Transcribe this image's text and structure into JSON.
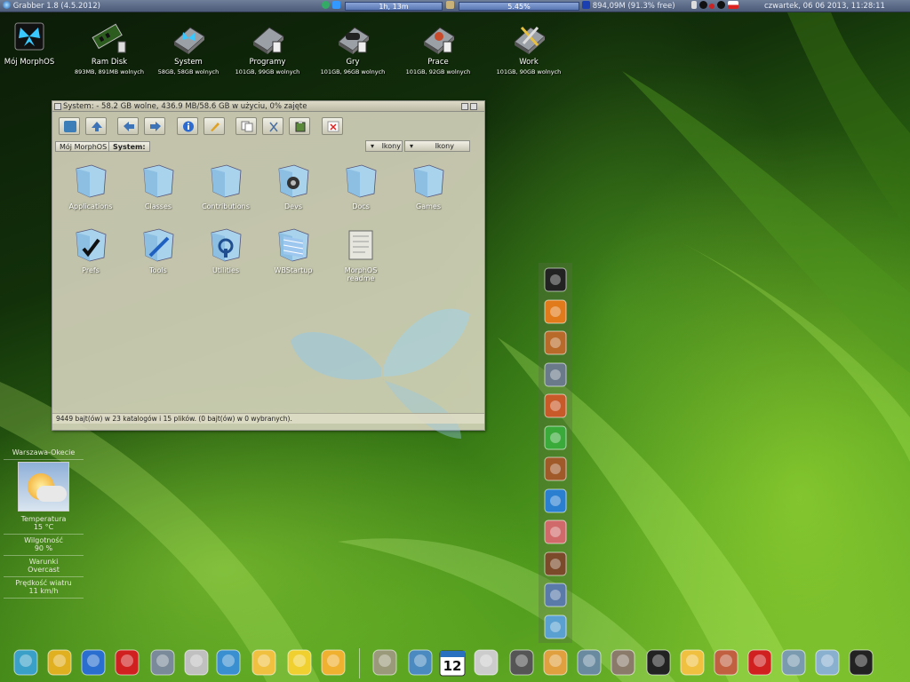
{
  "menubar": {
    "app_title": "Grabber 1.8 (4.5.2012)",
    "uptime": "1h, 13m",
    "cpu": "5.45%",
    "memory": "894,09M (91.3% free)",
    "datetime": "czwartek, 06 06 2013, 11:28:11"
  },
  "desktop_icons": [
    {
      "label": "Mój MorphOS",
      "sub": "",
      "icon": "butterfly-icon"
    },
    {
      "label": "Ram Disk",
      "sub": "893MB, 891MB wolnych",
      "icon": "ram-disk-icon"
    },
    {
      "label": "System",
      "sub": "58GB, 58GB wolnych",
      "icon": "system-drive-icon"
    },
    {
      "label": "Programy",
      "sub": "101GB, 99GB wolnych",
      "icon": "drive-icon"
    },
    {
      "label": "Gry",
      "sub": "101GB, 96GB wolnych",
      "icon": "drive-games-icon"
    },
    {
      "label": "Prace",
      "sub": "101GB, 92GB wolnych",
      "icon": "drive-icon"
    },
    {
      "label": "Work",
      "sub": "101GB, 90GB wolnych",
      "icon": "drive-tools-icon"
    }
  ],
  "window": {
    "title": "System: - 58.2 GB wolne, 436.9 MB/58.6 GB w użyciu, 0% zajęte",
    "breadcrumbs": [
      "Mój MorphOS",
      "System:"
    ],
    "view_options": [
      "Ikony",
      "Ikony"
    ],
    "folders": [
      {
        "label": "Applications",
        "icon": "folder-icon"
      },
      {
        "label": "Classes",
        "icon": "folder-icon"
      },
      {
        "label": "Contributions",
        "icon": "folder-icon"
      },
      {
        "label": "Devs",
        "icon": "folder-devs-icon"
      },
      {
        "label": "Docs",
        "icon": "folder-icon"
      },
      {
        "label": "Games",
        "icon": "folder-icon"
      },
      {
        "label": "Prefs",
        "icon": "folder-prefs-icon"
      },
      {
        "label": "Tools",
        "icon": "folder-tools-icon"
      },
      {
        "label": "Utilities",
        "icon": "folder-utilities-icon"
      },
      {
        "label": "WBStartup",
        "icon": "folder-wbstartup-icon"
      },
      {
        "label": "MorphOS\nreadme",
        "icon": "readme-icon"
      }
    ],
    "status": "9449 bajt(ów) w 23 katalogów i 15 plików. (0 bajt(ów) w 0 wybranych)."
  },
  "weather": {
    "location": "Warszawa-Okecie",
    "temp_label": "Temperatura",
    "temp_value": "15 °C",
    "humidity_label": "Wilgotność",
    "humidity_value": "90 %",
    "cond_label": "Warunki",
    "cond_value": "Overcast",
    "wind_label": "Prędkość wiatru",
    "wind_value": "11 km/h"
  },
  "vertical_dock": [
    "morphos-logo-icon",
    "media-player-icon",
    "paint-brushes-icon",
    "photo-viewer-icon",
    "art-palette-icon",
    "recycle-ring-icon",
    "paint-tools-icon",
    "disk-mount-icon",
    "document-edit-icon",
    "brush-icon",
    "screenshot-icon",
    "clipboard-icon"
  ],
  "bottom_dock": [
    "cube-icon",
    "sun-settings-icon",
    "notepad-icon",
    "pdf-icon",
    "tools-icon",
    "clock-icon",
    "globe-icon",
    "mail-icon",
    "duck-icon",
    "weather-icon",
    "calculator-icon",
    "network-icon",
    "calendar-icon",
    "notes-icon",
    "joystick-icon",
    "palette-icon",
    "image-viewer-icon",
    "video-reel-icon",
    "headphones-icon",
    "cd-icon",
    "paint-icon",
    "first-aid-icon",
    "magnifier-icon",
    "clipboard-icon",
    "tuxedo-icon"
  ],
  "calendar_day": "12",
  "colors": {
    "accent": "#5a78b4",
    "wallpaper": "#4f9a1c"
  }
}
